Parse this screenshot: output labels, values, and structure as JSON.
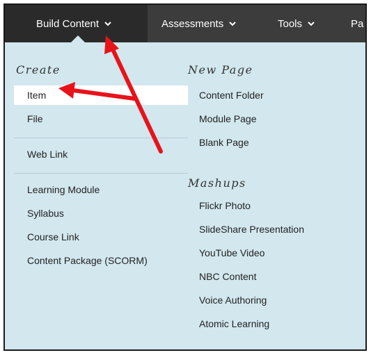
{
  "nav": {
    "tabs": [
      {
        "label": "Build Content",
        "icon": "chevron-down-icon"
      },
      {
        "label": "Assessments",
        "icon": "chevron-down-icon"
      },
      {
        "label": "Tools",
        "icon": "chevron-down-icon"
      },
      {
        "label": "Pa"
      }
    ]
  },
  "menu": {
    "create": {
      "heading": "Create",
      "items": [
        "Item",
        "File",
        "Web Link",
        "Learning Module",
        "Syllabus",
        "Course Link",
        "Content Package (SCORM)"
      ],
      "highlighted": "Item"
    },
    "new_page": {
      "heading": "New Page",
      "items": [
        "Content Folder",
        "Module Page",
        "Blank Page"
      ]
    },
    "mashups": {
      "heading": "Mashups",
      "items": [
        "Flickr Photo",
        "SlideShare Presentation",
        "YouTube Video",
        "NBC Content",
        "Voice Authoring",
        "Atomic Learning"
      ]
    }
  },
  "annotation": {
    "color": "#e8121b"
  }
}
